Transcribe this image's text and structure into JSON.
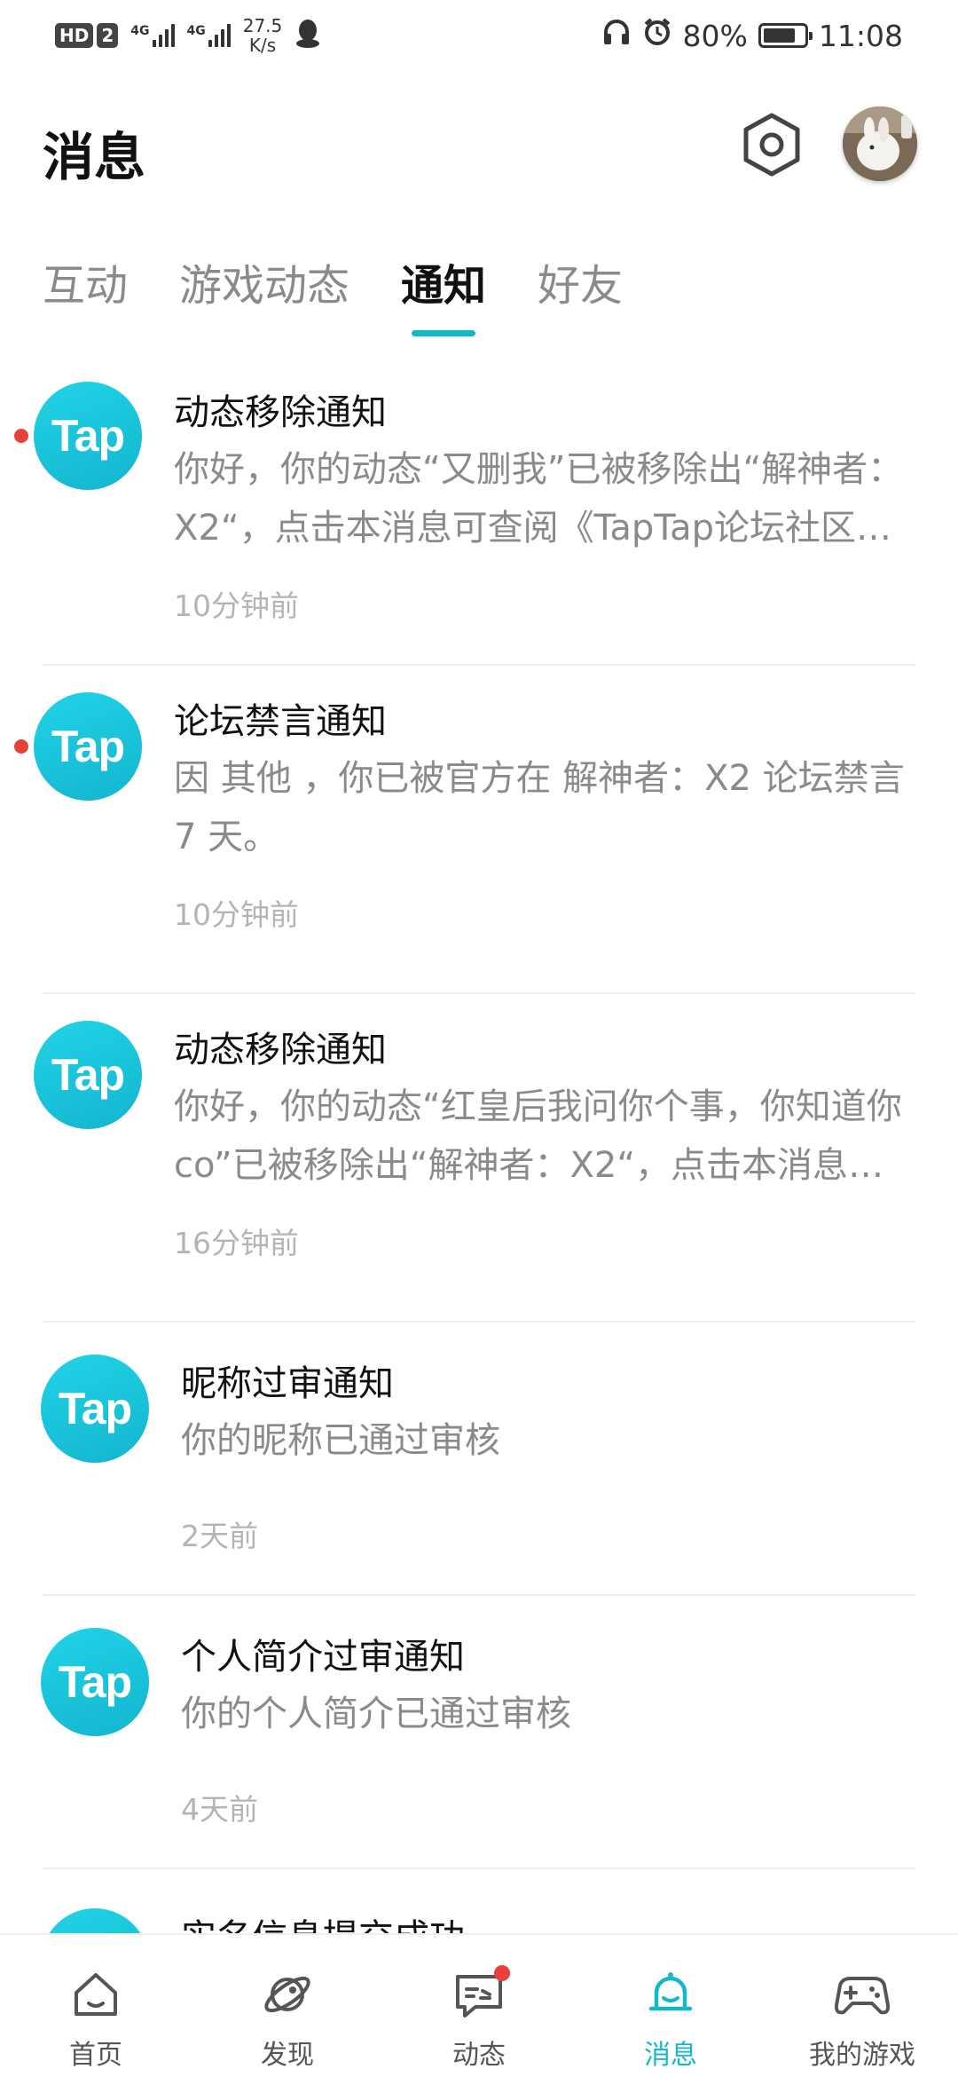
{
  "status_bar": {
    "badge_hd": "HD",
    "badge_sim": "2",
    "net1": "4G",
    "net2": "4G",
    "speed_value": "27.5",
    "speed_unit": "K/s",
    "battery": "80%",
    "battery_level": 0.8,
    "time": "11:08"
  },
  "header": {
    "title": "消息",
    "settings_icon": "settings-hexagon-icon",
    "avatar_icon": "user-avatar"
  },
  "tabs": [
    {
      "label": "互动",
      "active": false
    },
    {
      "label": "游戏动态",
      "active": false
    },
    {
      "label": "通知",
      "active": true
    },
    {
      "label": "好友",
      "active": false
    }
  ],
  "notifications": [
    {
      "logo": "Tap",
      "title": "动态移除通知",
      "body": "你好，你的动态“又删我”已被移除出“解神者：X2“，点击本消息可查阅《TapTap论坛社区规范》",
      "time": "10分钟前",
      "unread": true
    },
    {
      "logo": "Tap",
      "title": "论坛禁言通知",
      "body": "因 其他 ，你已被官方在 解神者：X2 论坛禁言 7 天。",
      "time": "10分钟前",
      "unread": true
    },
    {
      "logo": "Tap",
      "title": "动态移除通知",
      "body": "你好，你的动态“红皇后我问你个事，你知道你co”已被移除出“解神者：X2“，点击本消息可查阅",
      "time": "16分钟前",
      "unread": false
    },
    {
      "logo": "Tap",
      "title": "昵称过审通知",
      "body": "你的昵称已通过审核",
      "time": "2天前",
      "unread": false
    },
    {
      "logo": "Tap",
      "title": "个人简介过审通知",
      "body": "你的个人简介已通过审核",
      "time": "4天前",
      "unread": false
    },
    {
      "logo": "Tap",
      "title": "实名信息提交成功",
      "body": "",
      "time": "",
      "unread": false
    }
  ],
  "bottom_nav": [
    {
      "label": "首页",
      "icon": "home-icon",
      "active": false,
      "badge": false
    },
    {
      "label": "发现",
      "icon": "planet-icon",
      "active": false,
      "badge": false
    },
    {
      "label": "动态",
      "icon": "chat-icon",
      "active": false,
      "badge": true
    },
    {
      "label": "消息",
      "icon": "bell-icon",
      "active": true,
      "badge": false
    },
    {
      "label": "我的游戏",
      "icon": "gamepad-icon",
      "active": false,
      "badge": false
    }
  ],
  "colors": {
    "accent": "#14b9c8",
    "unread_dot": "#e8413a",
    "title": "#111111",
    "body": "#8a8a8a",
    "time": "#b4b4b4"
  }
}
